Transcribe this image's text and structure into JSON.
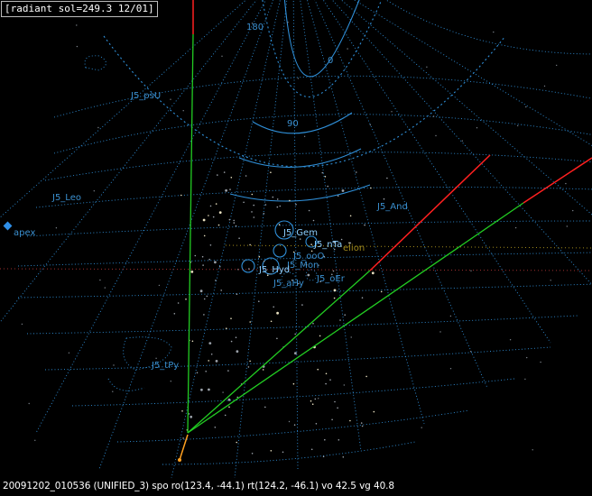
{
  "header": {
    "text": "[radiant sol=249.3 12/01]"
  },
  "footer": {
    "text": "20091202_010536 (UNIFIED_3) spo ro(123.4, -44.1) rt(124.2, -46.1) vo 42.5 vg 40.8"
  },
  "angle_labels": {
    "a180": "180",
    "a0": "0",
    "a90": "90"
  },
  "markers": {
    "apex": "apex",
    "helion": "elion"
  },
  "showers": [
    "J5_psU",
    "J5_Leo",
    "J5_And",
    "J5_Gem",
    "J5_nTa",
    "J5_ooO",
    "J5_Mon",
    "J5_Hyd",
    "J5_aHy",
    "J5_oEr",
    "J5_tPy"
  ],
  "colors": {
    "grid": "#2f8fd8",
    "label": "#3a8fcf",
    "bright_label": "#8ccfff",
    "apex": "#2f8fe8",
    "helion": "#a08a1c",
    "red": "#ff2020",
    "green": "#22cc22",
    "orange": "#ffa020"
  }
}
